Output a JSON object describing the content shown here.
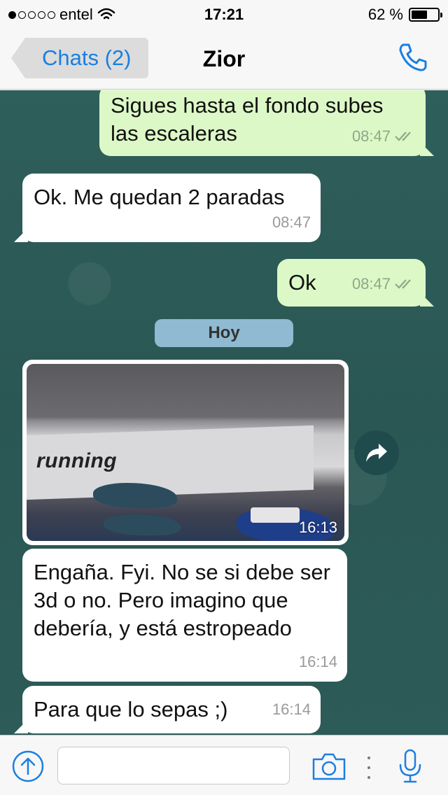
{
  "status_bar": {
    "carrier": "entel",
    "time": "17:21",
    "battery_percent": "62 %",
    "battery_level": 0.62,
    "signal_bars": 1
  },
  "nav": {
    "back_label": "Chats (2)",
    "title": "Zior",
    "call_icon": "phone-icon"
  },
  "chat": {
    "messages": [
      {
        "direction": "outgoing",
        "text": "Sigues hasta el fondo subes las escaleras",
        "time": "08:47",
        "status": "read-double-check"
      },
      {
        "direction": "incoming",
        "text": "Ok. Me quedan 2 paradas",
        "time": "08:47"
      },
      {
        "direction": "outgoing",
        "text": "Ok",
        "time": "08:47",
        "status": "read-double-check"
      },
      {
        "direction": "incoming",
        "type": "image",
        "image_text": "running",
        "time": "16:13"
      },
      {
        "direction": "incoming",
        "text": "Engaña. Fyi. No se si debe ser 3d o no. Pero imagino que debería, y está estropeado",
        "time": "16:14"
      },
      {
        "direction": "incoming",
        "text": "Para que lo sepas ;)",
        "time": "16:14"
      }
    ],
    "date_separator": "Hoy"
  },
  "input_bar": {
    "placeholder": "",
    "value": ""
  },
  "colors": {
    "accent": "#1a7fe0",
    "outgoing_bubble": "#dcf8c6",
    "incoming_bubble": "#ffffff",
    "chat_background": "#2d5b57",
    "date_chip": "#8fbad2"
  }
}
